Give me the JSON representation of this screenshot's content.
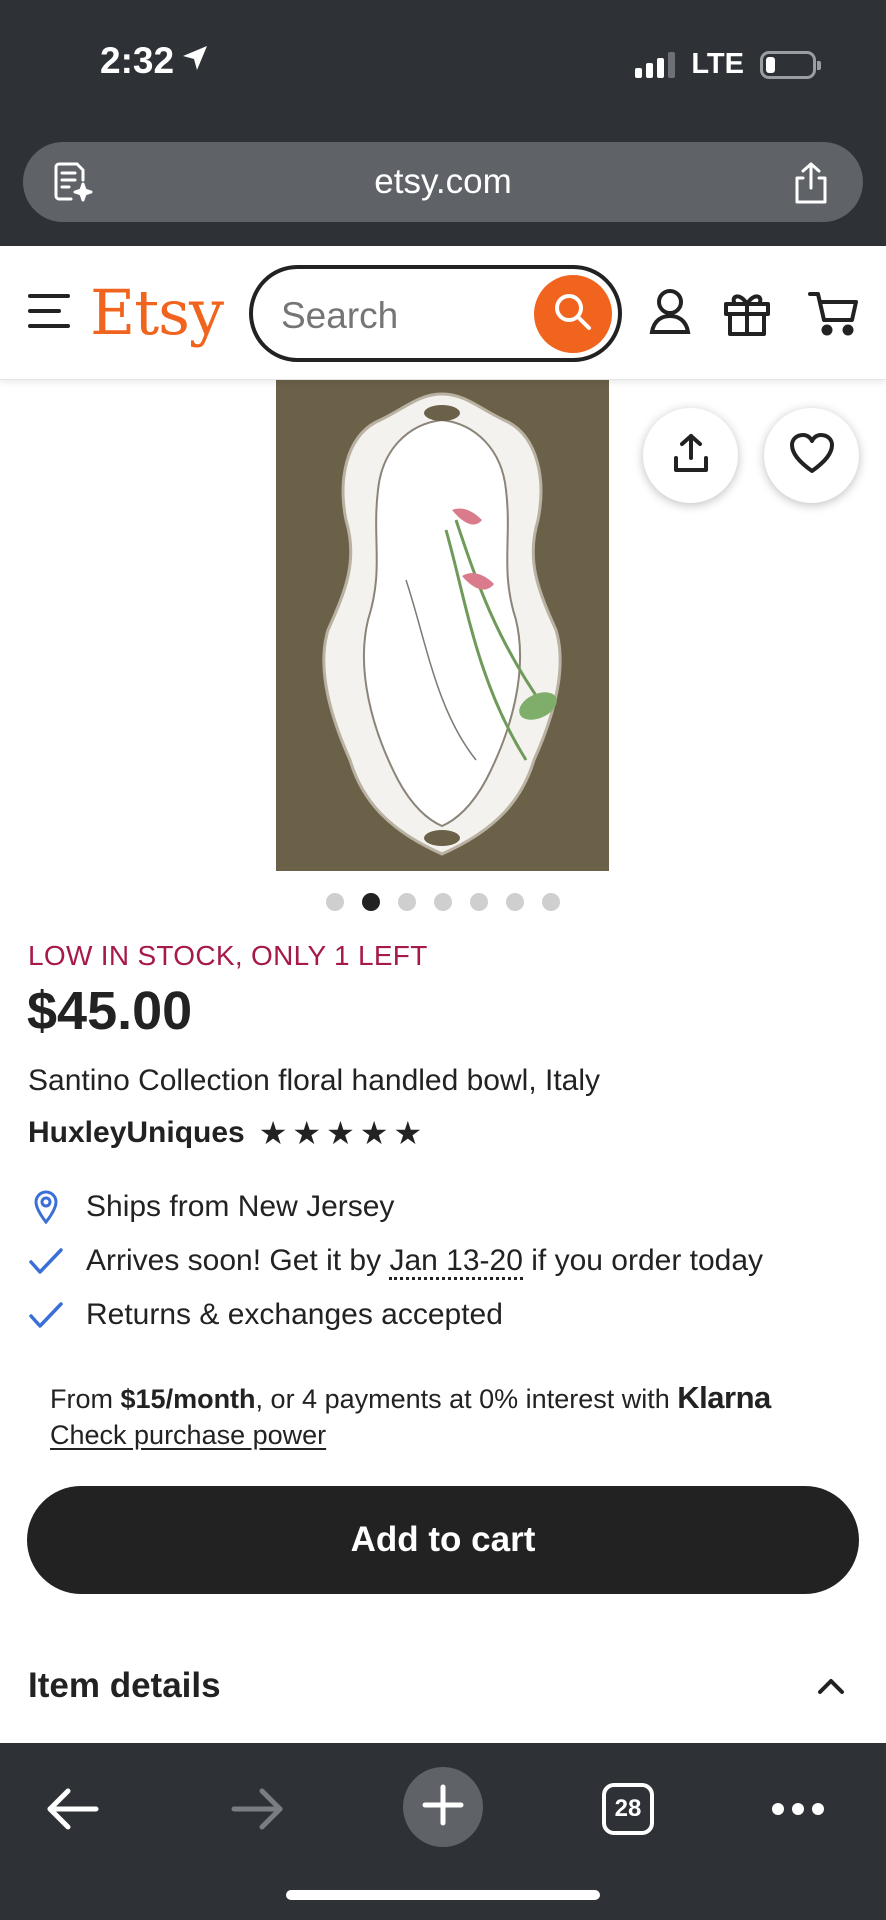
{
  "status_bar": {
    "time": "2:32",
    "network": "LTE",
    "battery_fraction": 0.2
  },
  "browser": {
    "url": "etsy.com",
    "tab_count": "28"
  },
  "header": {
    "logo": "Etsy",
    "search_placeholder": "Search",
    "accent_color": "#f1641e"
  },
  "gallery": {
    "image_count": 7,
    "active_index": 1
  },
  "product": {
    "stock_notice": "LOW IN STOCK, ONLY 1 LEFT",
    "price": "$45.00",
    "title": "Santino Collection floral handled bowl, Italy",
    "shop_name": "HuxleyUniques",
    "rating_stars": 5
  },
  "shipping": {
    "ships_from": "Ships from New Jersey",
    "arrives_prefix": "Arrives soon! Get it by",
    "arrives_date": "Jan 13-20",
    "arrives_suffix": "if you order today",
    "returns": "Returns & exchanges accepted"
  },
  "klarna": {
    "prefix": "From",
    "monthly": "$15/month",
    "middle": ", or 4 payments at 0% interest with",
    "brand": "Klarna",
    "link": "Check purchase power"
  },
  "cta": {
    "add_to_cart": "Add to cart"
  },
  "details": {
    "title": "Item details"
  }
}
